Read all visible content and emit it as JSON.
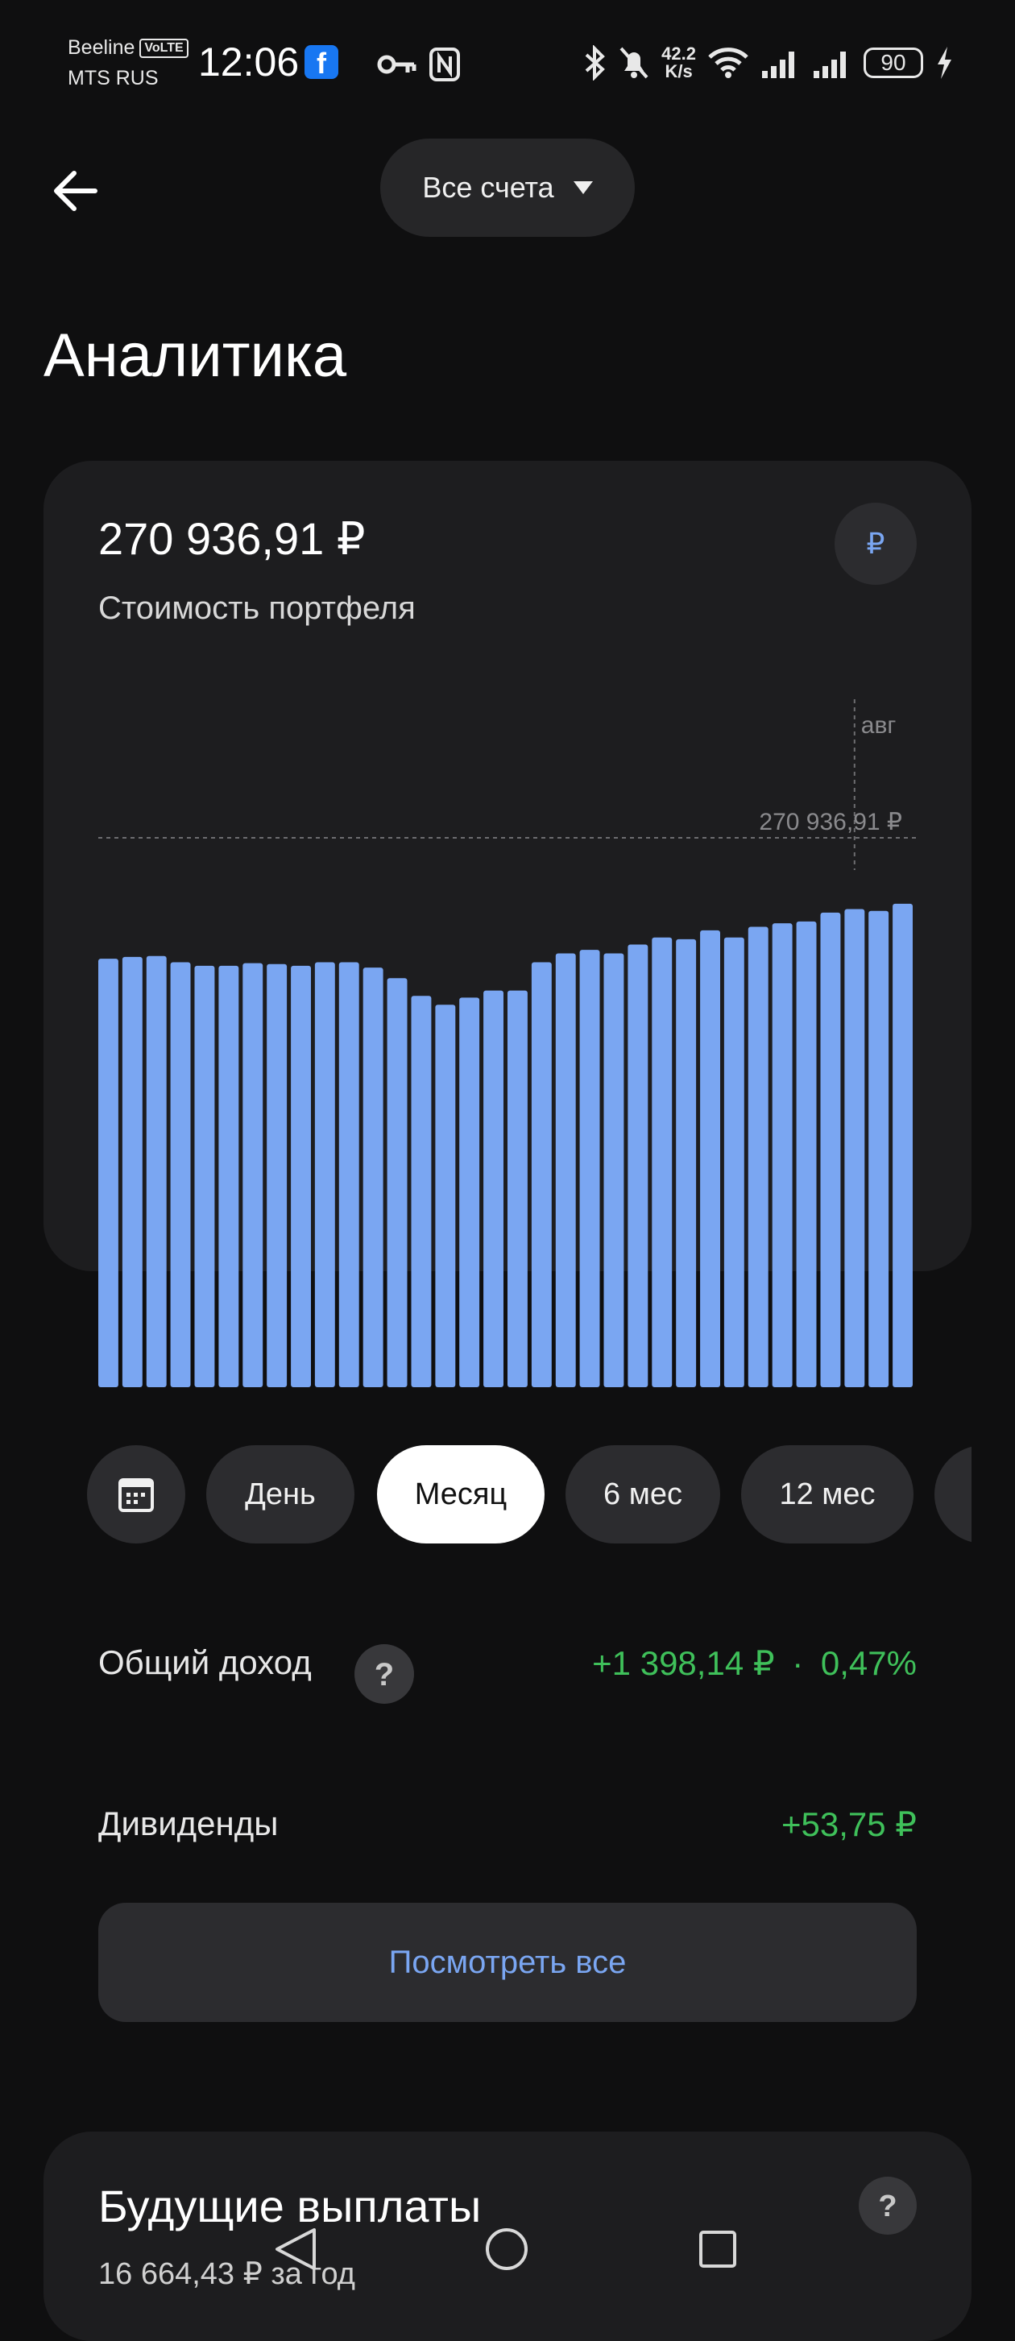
{
  "status_bar": {
    "carrier_1": "Beeline",
    "volte": "VoLTE",
    "carrier_2": "MTS RUS",
    "time": "12:06",
    "net_speed_value": "42.2",
    "net_speed_unit": "K/s",
    "battery": "90",
    "icons": [
      "facebook-icon",
      "key-icon",
      "nfc-icon",
      "bluetooth-icon",
      "bell-off-icon",
      "wifi-icon",
      "signal-icon",
      "signal-icon",
      "charging-icon"
    ]
  },
  "header": {
    "account_selector": "Все счета",
    "title": "Аналитика"
  },
  "portfolio": {
    "value": "270 936,91 ₽",
    "label": "Стоимость портфеля",
    "currency_button": "₽"
  },
  "chart_data": {
    "type": "bar",
    "x_label_marker": "авг",
    "marker_value_label": "270 936,91 ₽",
    "marker_value": 270936.91,
    "color": "#7aa6f2",
    "values": [
      264200,
      264300,
      264350,
      264000,
      263800,
      263800,
      263950,
      263900,
      263800,
      264000,
      264000,
      263700,
      263100,
      262100,
      261600,
      262000,
      262400,
      262400,
      264000,
      264500,
      264700,
      264500,
      265000,
      265400,
      265300,
      265800,
      265400,
      266000,
      266200,
      266300,
      266800,
      267000,
      266900,
      267300
    ]
  },
  "periods": {
    "calendar_icon": "calendar-icon",
    "items": [
      "День",
      "Месяц",
      "6 мес",
      "12 мес"
    ],
    "active": "Месяц"
  },
  "income": {
    "label": "Общий доход",
    "help": "?",
    "amount": "+1 398,14 ₽",
    "dot": "·",
    "percent": "0,47%"
  },
  "dividends": {
    "label": "Дивиденды",
    "amount": "+53,75 ₽"
  },
  "see_all": "Посмотреть все",
  "future": {
    "title": "Будущие выплаты",
    "subtitle": "16 664,43 ₽ за год",
    "help": "?"
  },
  "colors": {
    "background": "#0f0f10",
    "card": "#1d1d1f",
    "accent": "#7aa6f2",
    "positive": "#3fc05a"
  }
}
